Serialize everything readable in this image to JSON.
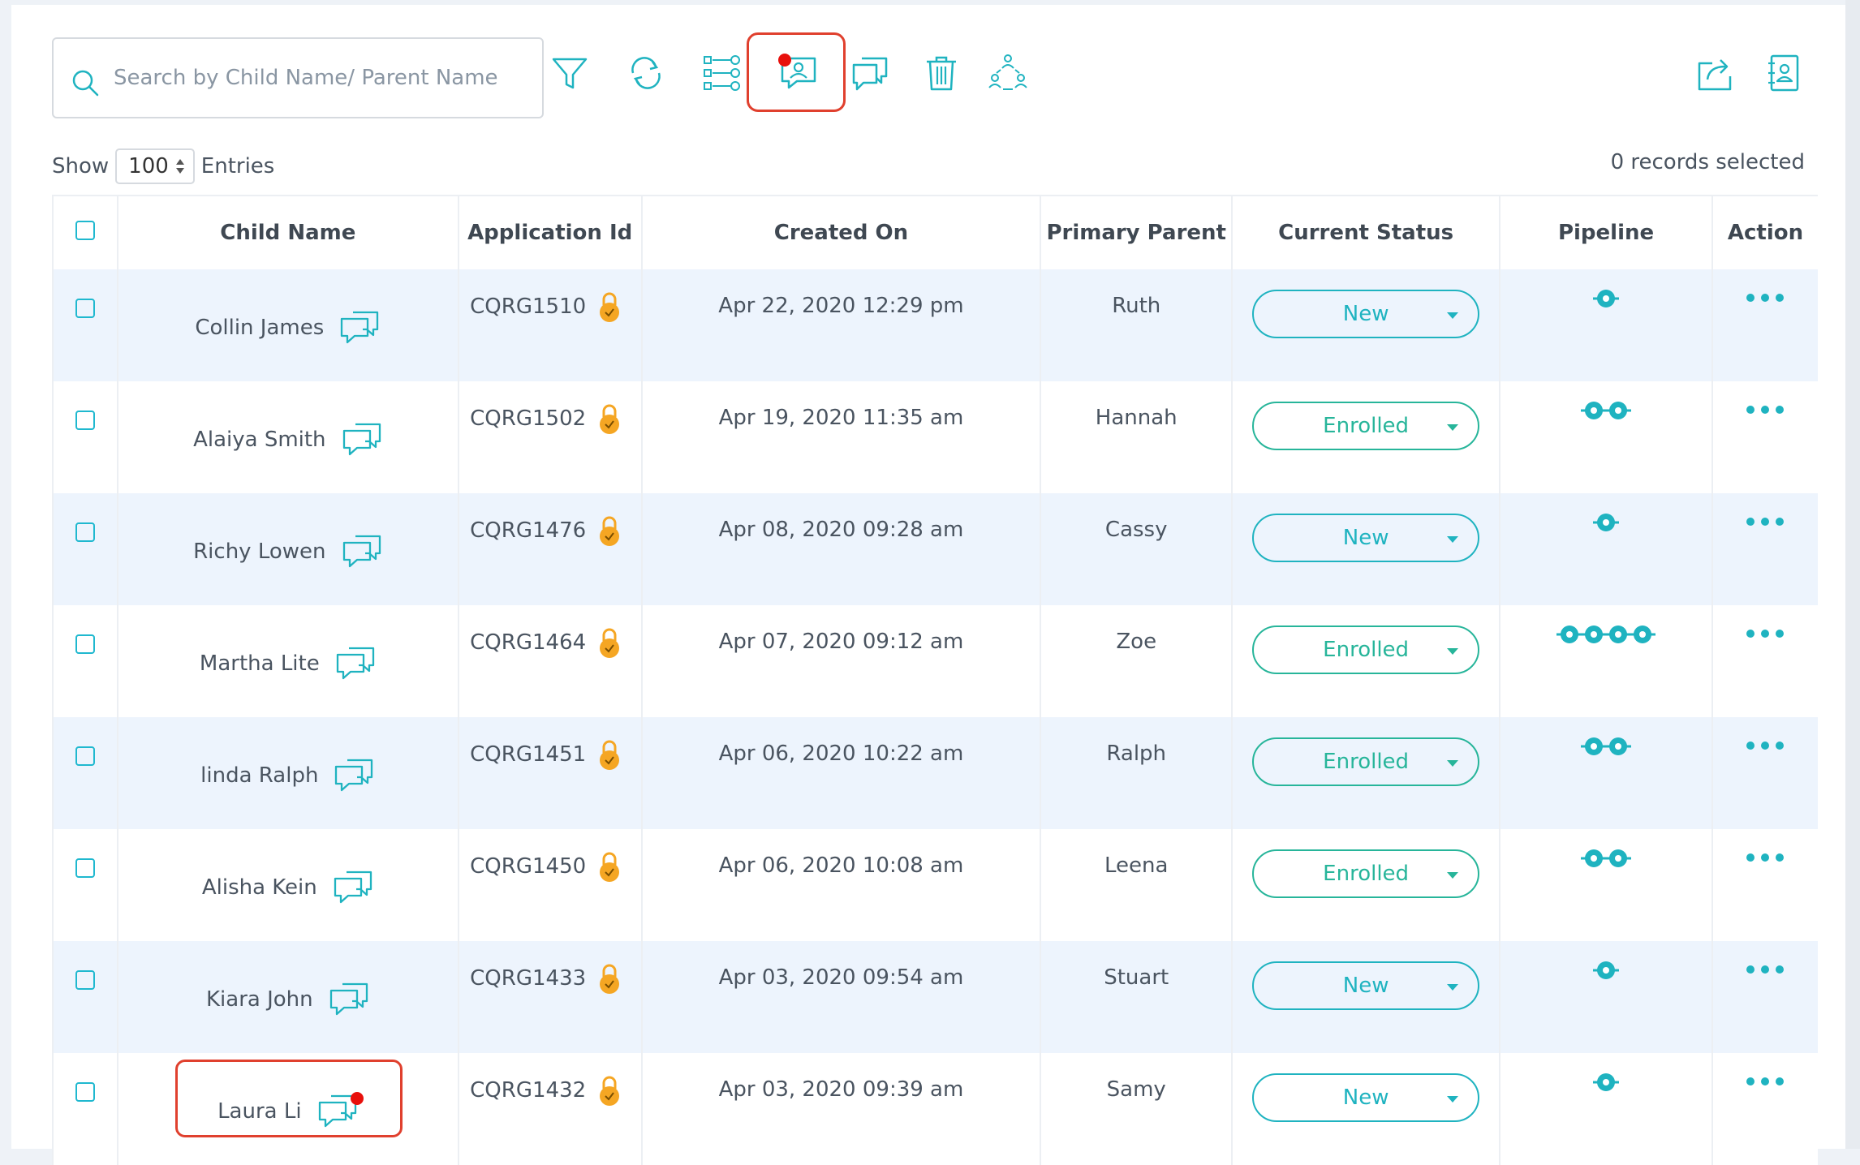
{
  "search": {
    "placeholder": "Search by Child Name/ Parent Name"
  },
  "toolbar": {
    "icons": [
      "filter-icon",
      "refresh-icon",
      "workflow-icon",
      "parent-message-icon",
      "chat-icon",
      "trash-icon",
      "team-icon",
      "export-icon",
      "contact-book-icon"
    ]
  },
  "entries": {
    "show_label": "Show",
    "value": "100",
    "entries_label": "Entries"
  },
  "records_selected": "0 records selected",
  "table": {
    "headers": [
      "Child Name",
      "Application Id",
      "Created On",
      "Primary Parent",
      "Current Status",
      "Pipeline",
      "Action"
    ],
    "rows": [
      {
        "child": "Collin James",
        "app_id": "CQRG1510",
        "created": "Apr 22, 2020 12:29 pm",
        "parent": "Ruth",
        "status": "New",
        "pipeline": 1
      },
      {
        "child": "Alaiya Smith",
        "app_id": "CQRG1502",
        "created": "Apr 19, 2020 11:35 am",
        "parent": "Hannah",
        "status": "Enrolled",
        "pipeline": 2
      },
      {
        "child": "Richy Lowen",
        "app_id": "CQRG1476",
        "created": "Apr 08, 2020 09:28 am",
        "parent": "Cassy",
        "status": "New",
        "pipeline": 1
      },
      {
        "child": "Martha Lite",
        "app_id": "CQRG1464",
        "created": "Apr 07, 2020 09:12 am",
        "parent": "Zoe",
        "status": "Enrolled",
        "pipeline": 4
      },
      {
        "child": "linda Ralph",
        "app_id": "CQRG1451",
        "created": "Apr 06, 2020 10:22 am",
        "parent": "Ralph",
        "status": "Enrolled",
        "pipeline": 2
      },
      {
        "child": "Alisha Kein",
        "app_id": "CQRG1450",
        "created": "Apr 06, 2020 10:08 am",
        "parent": "Leena",
        "status": "Enrolled",
        "pipeline": 2
      },
      {
        "child": "Kiara John",
        "app_id": "CQRG1433",
        "created": "Apr 03, 2020 09:54 am",
        "parent": "Stuart",
        "status": "New",
        "pipeline": 1
      },
      {
        "child": "Laura Li",
        "app_id": "CQRG1432",
        "created": "Apr 03, 2020 09:39 am",
        "parent": "Samy",
        "status": "New",
        "pipeline": 1
      }
    ]
  },
  "colors": {
    "accent": "#1fb3c0",
    "highlight": "#e0402e",
    "row_alt": "#edf4fd",
    "notify": "#e8100c",
    "lock": "#f5a623"
  }
}
